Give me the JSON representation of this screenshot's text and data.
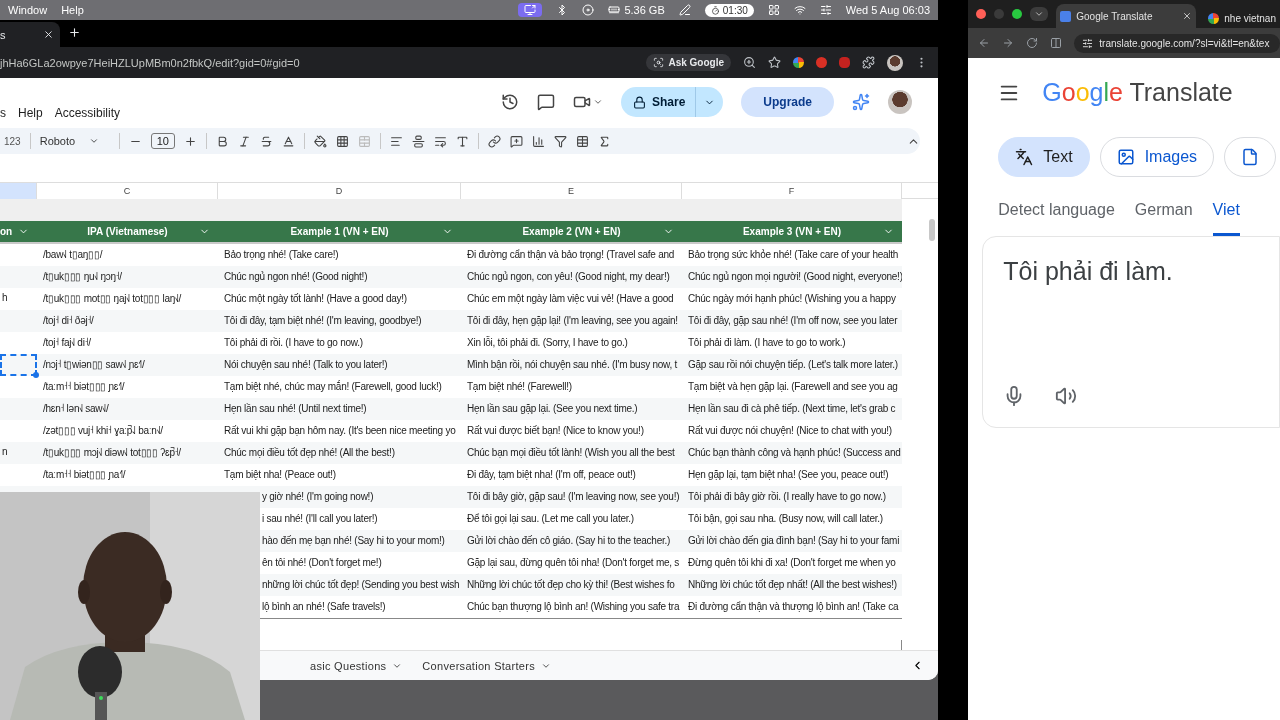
{
  "menubar": {
    "items": [
      "Window",
      "Help"
    ],
    "memory": "5.36 GB",
    "timer": "01:30",
    "clock": "Wed 5 Aug 06:03"
  },
  "left_browser": {
    "tab": {
      "title": "s"
    },
    "address": "jhHa6GLa2owpye7HeiHZLUpMBm0n2fbkQ/edit?gid=0#gid=0",
    "ask_google": "Ask Google"
  },
  "sheets": {
    "menu": [
      "s",
      "Help",
      "Accessibility"
    ],
    "share": "Share",
    "upgrade": "Upgrade",
    "toolbar": {
      "format": "123",
      "font": "Roboto",
      "font_size": "10"
    },
    "column_letters": [
      "C",
      "D",
      "E",
      "F"
    ],
    "header": [
      "on",
      "IPA (Vietnamese)",
      "Example 1 (VN + EN)",
      "Example 2 (VN + EN)",
      "Example 3 (VN + EN)"
    ],
    "rows": [
      {
        "selected": false,
        "c": "/baw˧˩ t▯aŋ▯▯/",
        "d": "Bảo trọng nhé! (Take care!)",
        "e": "Đi đường cẩn thận và bảo trọng! (Travel safe and",
        "f": "Bảo trọng sức khỏe nhé! (Take care of your health"
      },
      {
        "selected": false,
        "c": "/t▯uk▯▯▯ ŋu˧˩ ŋɔŋ˧/",
        "d": "Chúc ngủ ngon nhé! (Good night!)",
        "e": "Chúc ngủ ngon, con yêu! (Good night, my dear!)",
        "f": "Chúc ngủ ngon mọi người! (Good night, everyone!)"
      },
      {
        "selected": false,
        "b": "h",
        "c": "/t▯uk▯▯▯ mot▯▯ ŋaj˧˩ tot▯▯▯ laŋ˧˩/",
        "d": "Chúc một ngày tốt lành! (Have a good day!)",
        "e": "Chúc em một ngày làm việc vui vẻ! (Have a good",
        "f": "Chúc ngày mới hạnh phúc! (Wishing you a happy"
      },
      {
        "selected": false,
        "c": "/toj˧ di˧ ðəj˧/",
        "d": "Tôi đi đây, tạm biệt nhé! (I'm leaving, goodbye!)",
        "e": "Tôi đi đây, hẹn gặp lại! (I'm leaving, see you again!",
        "f": "Tôi đi đây, gặp sau nhé! (I'm off now, see you later"
      },
      {
        "selected": false,
        "c": "/toj˧ faj˧˩ di˧/",
        "d": "Tôi phải đi rồi. (I have to go now.)",
        "e": "Xin lỗi, tôi phải đi. (Sorry, I have to go.)",
        "f": "Tôi phải đi làm. (I have to go to work.)"
      },
      {
        "selected": true,
        "c": "/nɔj˧ t▯wiən▯▯ saw˧˩ ɲɛ˧˥/",
        "d": "Nói chuyện sau nhé! (Talk to you later!)",
        "e": "Mình bận rồi, nói chuyện sau nhé. (I'm busy now, t",
        "f": "Gặp sau rồi nói chuyện tiếp. (Let's talk more later.)"
      },
      {
        "selected": false,
        "c": "/taːm˧˧ biət▯▯▯ ɲɛ˧˥/",
        "d": "Tạm biệt nhé, chúc may mắn! (Farewell, good luck!)",
        "e": "Tạm biệt nhé! (Farewell!)",
        "f": "Tạm biệt và hẹn gặp lại. (Farewell and see you ag"
      },
      {
        "selected": false,
        "c": "/hɛn˧ lən˧˩ saw˧˩/",
        "d": "Hẹn lần sau nhé! (Until next time!)",
        "e": "Hẹn lần sau gặp lại. (See you next time.)",
        "f": "Hẹn lần sau đi cà phê tiếp. (Next time, let's grab c"
      },
      {
        "selected": false,
        "c": "/zət▯▯▯ vuj˧ khi˧ ɣaːp̚˨˩ baːn˧˩/",
        "d": "Rất vui khi gặp bạn hôm nay. (It's been nice meeting yo",
        "e": "Rất vui được biết bạn! (Nice to know you!)",
        "f": "Rất vui được nói chuyện! (Nice to chat with you!)"
      },
      {
        "selected": false,
        "b": "n",
        "c": "/t▯uk▯▯▯ mɔj˧˩ diəw˧˩ tot▯▯▯ ʔɛp̚˧/",
        "d": "Chúc mọi điều tốt đẹp nhé! (All the best!)",
        "e": "Chúc bạn mọi điều tốt lành! (Wish you all the best",
        "f": "Chúc bạn thành công và hạnh phúc! (Success and"
      },
      {
        "selected": false,
        "c": "/taːm˧˧ biət▯▯▯ ɲa˧˥/",
        "d": "Tạm biệt nha! (Peace out!)",
        "e": "Đi đây, tạm biệt nha! (I'm off, peace out!)",
        "f": "Hẹn gặp lại, tạm biệt nha! (See you, peace out!)"
      },
      {
        "d": "y giờ nhé! (I'm going now!)",
        "e": "Tôi đi bây giờ, gặp sau! (I'm leaving now, see you!)",
        "f": "Tôi phải đi bây giờ rồi. (I really have to go now.)"
      },
      {
        "d": "i sau nhé! (I'll call you later!)",
        "e": "Để tôi gọi lại sau. (Let me call you later.)",
        "f": "Tôi bận, gọi sau nha. (Busy now, will call later.)"
      },
      {
        "d": "hào đến mẹ bạn nhé! (Say hi to your mom!)",
        "e": "Gửi lời chào đến cô giáo. (Say hi to the teacher.)",
        "f": "Gửi lời chào đến gia đình bạn! (Say hi to your fami"
      },
      {
        "d": "ên tôi nhé! (Don't forget me!)",
        "e": "Gặp lại sau, đừng quên tôi nha! (Don't forget me, s",
        "f": "Đừng quên tôi khi đi xa! (Don't forget me when yo"
      },
      {
        "d": "những lời chúc tốt đẹp! (Sending you best wish",
        "e": "Những lời chúc tốt đẹp cho kỳ thi! (Best wishes fo",
        "f": "Những lời chúc tốt đẹp nhất! (All the best wishes!)"
      },
      {
        "d": "lộ bình an nhé! (Safe travels!)",
        "e": "Chúc bạn thượng lộ bình an! (Wishing you safe tra",
        "f": "Đi đường cẩn thận và thượng lộ bình an! (Take ca"
      }
    ],
    "sheet_tabs": [
      "asic Questions",
      "Conversation Starters"
    ]
  },
  "right_browser": {
    "tabs": [
      {
        "title": "Google Translate",
        "selected": true
      },
      {
        "title": "nhe vietnan",
        "selected": false
      }
    ],
    "address": "translate.google.com/?sl=vi&tl=en&tex",
    "logo": {
      "brand": "Google",
      "product": "Translate"
    },
    "modes": [
      {
        "label": "Text",
        "selected": true
      },
      {
        "label": "Images",
        "selected": false
      },
      {
        "selected": false
      }
    ],
    "languages": [
      {
        "label": "Detect language",
        "selected": false
      },
      {
        "label": "German",
        "selected": false
      },
      {
        "label": "Viet",
        "selected": true
      }
    ],
    "input_text": "Tôi phải đi làm."
  }
}
